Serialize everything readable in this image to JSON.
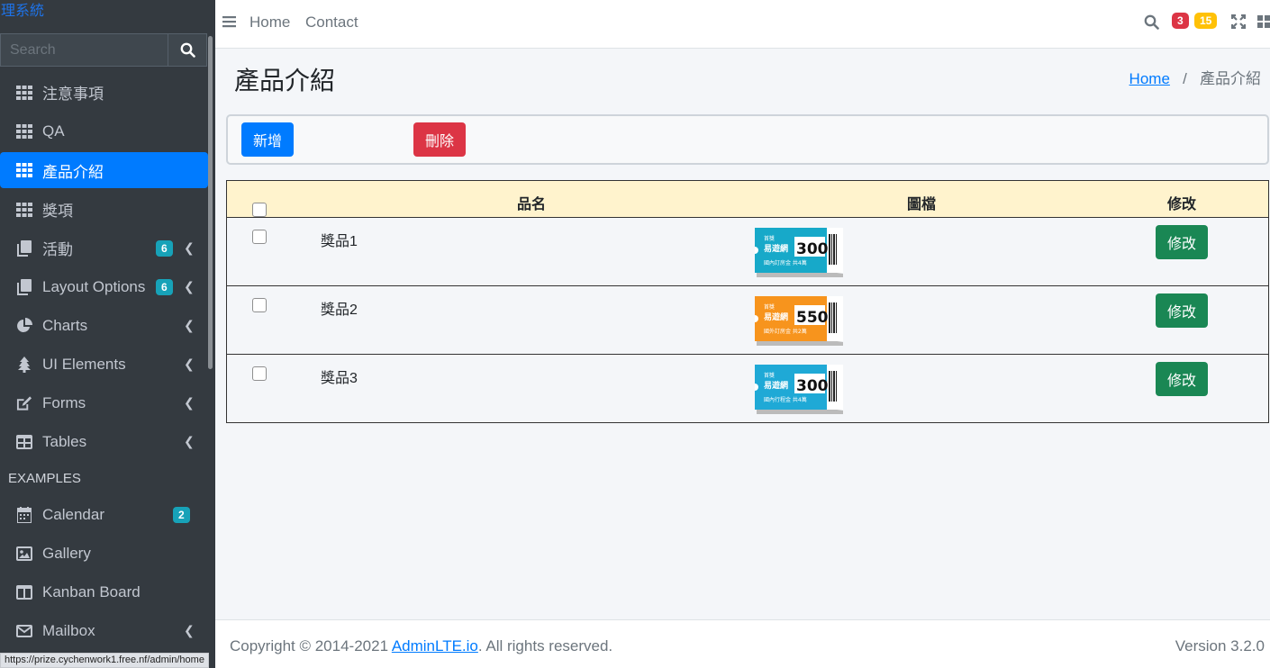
{
  "brand": "管理系統",
  "search": {
    "placeholder": "Search"
  },
  "sidebar": {
    "items": [
      {
        "label": "注意事項",
        "icon": "grid-icon"
      },
      {
        "label": "QA",
        "icon": "grid-icon"
      },
      {
        "label": "產品介紹",
        "icon": "grid-icon",
        "active": true
      },
      {
        "label": "獎項",
        "icon": "grid-icon"
      },
      {
        "label": "活動",
        "icon": "copy-icon",
        "badge": "6"
      },
      {
        "label": "Layout Options",
        "icon": "copy-icon",
        "badge": "6"
      },
      {
        "label": "Charts",
        "icon": "pie-chart-icon"
      },
      {
        "label": "UI Elements",
        "icon": "tree-icon"
      },
      {
        "label": "Forms",
        "icon": "edit-icon"
      },
      {
        "label": "Tables",
        "icon": "table-icon"
      }
    ],
    "header": "EXAMPLES",
    "examples": [
      {
        "label": "Calendar",
        "icon": "calendar-icon",
        "badge": "2"
      },
      {
        "label": "Gallery",
        "icon": "image-icon"
      },
      {
        "label": "Kanban Board",
        "icon": "columns-icon"
      },
      {
        "label": "Mailbox",
        "icon": "envelope-icon"
      }
    ]
  },
  "status_url": "https://prize.cychenwork1.free.nf/admin/home",
  "topnav": {
    "links": [
      "Home",
      "Contact"
    ],
    "badge_danger": "3",
    "badge_warning": "15"
  },
  "page": {
    "title": "產品介紹",
    "breadcrumb_home": "Home",
    "breadcrumb_current": "產品介紹",
    "add_label": "新增",
    "delete_label": "刪除"
  },
  "table": {
    "headers": [
      "品名",
      "圖檔",
      "修改"
    ],
    "rows": [
      {
        "name": "獎品1",
        "edit": "修改",
        "ticket": {
          "color": "#17a9c9",
          "amount": "300",
          "line1": "首獎",
          "line2": "易遊網",
          "line3": "國內訂房金 共4萬"
        }
      },
      {
        "name": "獎品2",
        "edit": "修改",
        "ticket": {
          "color": "#f7941d",
          "amount": "550",
          "line1": "首獎",
          "line2": "易遊網",
          "line3": "國外訂房金 共2萬"
        }
      },
      {
        "name": "獎品3",
        "edit": "修改",
        "ticket": {
          "color": "#1fa9d6",
          "amount": "300",
          "line1": "首獎",
          "line2": "易遊網",
          "line3": "國內行程金 共4萬"
        }
      }
    ]
  },
  "footer": {
    "copyright_prefix": "Copyright © 2014-2021 ",
    "link": "AdminLTE.io",
    "suffix": ". All rights reserved.",
    "version_label": "Version",
    "version": " 3.2.0"
  },
  "colors": {
    "primary": "#007bff",
    "danger": "#dc3545",
    "success": "#1a8754",
    "sidebar": "#343a40",
    "table_header": "#fff3cd"
  }
}
